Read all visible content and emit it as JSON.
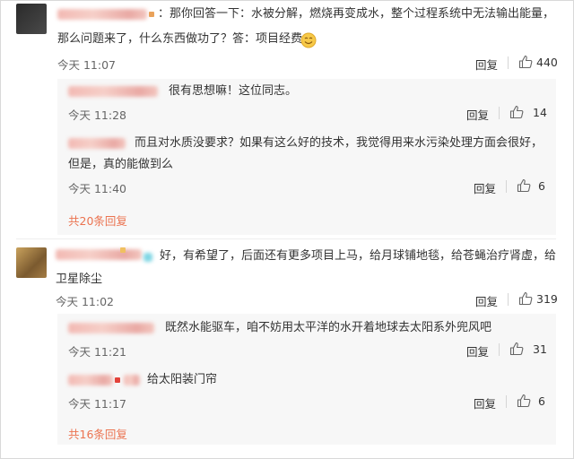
{
  "comments": [
    {
      "text_line1": "：那你回答一下：水被分解，燃烧再变成水，整个过程系统中无法输出能量，",
      "text_line2": "那么问题来了，什么东西做功了？答：项目经费",
      "time": "今天 11:07",
      "reply_label": "回复",
      "likes": "440",
      "replies": [
        {
          "text": "很有思想嘛！这位同志。",
          "time": "今天 11:28",
          "reply_label": "回复",
          "likes": "14"
        },
        {
          "text_line1": "而且对水质没要求？如果有这么好的技术，我觉得用来水污染处理方面会很好，",
          "text_line2": "但是，真的能做到么",
          "time": "今天 11:40",
          "reply_label": "回复",
          "likes": "6"
        }
      ],
      "more_replies": "共20条回复"
    },
    {
      "text_line1": "好，有希望了，后面还有更多项目上马，给月球铺地毯，给苍蝇治疗肾虚，给",
      "text_line2": "卫星除尘",
      "time": "今天 11:02",
      "reply_label": "回复",
      "likes": "319",
      "replies": [
        {
          "text": "既然水能驱车，咱不妨用太平洋的水开着地球去太阳系外兜风吧",
          "time": "今天 11:21",
          "reply_label": "回复",
          "likes": "31"
        },
        {
          "text": "给太阳装门帘",
          "time": "今天 11:17",
          "reply_label": "回复",
          "likes": "6"
        }
      ],
      "more_replies": "共16条回复"
    }
  ],
  "colors": {
    "link": "#eb7350",
    "reply_bg": "#f7f7f7",
    "text": "#333333",
    "meta": "#666666"
  },
  "icons": {
    "like": "thumbs-up-icon",
    "emoji": "smile-emoji"
  }
}
